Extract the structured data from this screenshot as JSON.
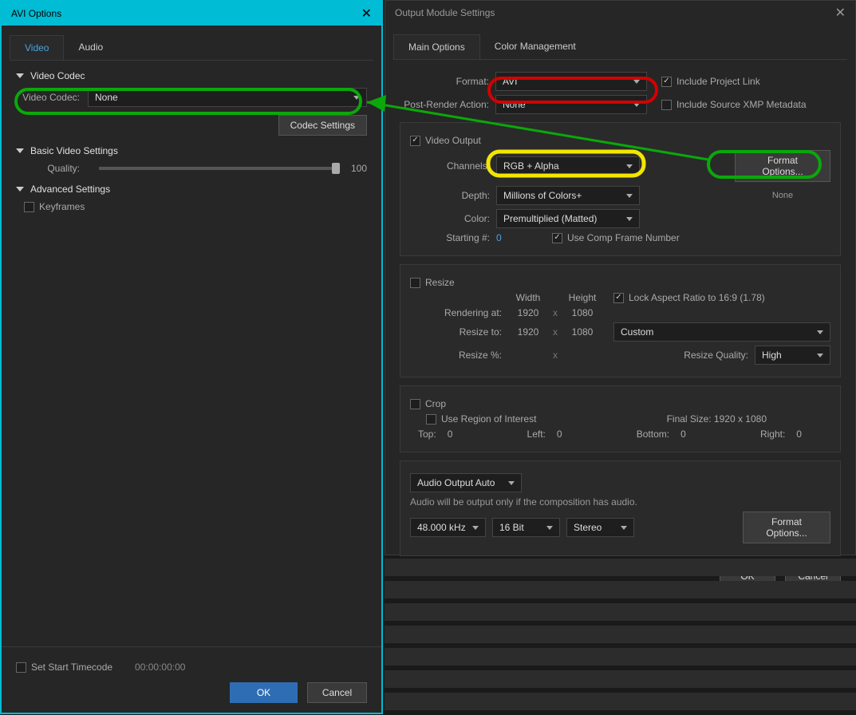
{
  "left": {
    "title": "AVI Options",
    "tabs": {
      "video": "Video",
      "audio": "Audio"
    },
    "sections": {
      "videoCodec": {
        "header": "Video Codec",
        "label": "Video Codec:",
        "value": "None",
        "codecSettingsBtn": "Codec Settings"
      },
      "basic": {
        "header": "Basic Video Settings",
        "qualityLabel": "Quality:",
        "qualityValue": "100"
      },
      "advanced": {
        "header": "Advanced Settings",
        "keyframesLabel": "Keyframes"
      }
    },
    "bottom": {
      "startTimecodeLabel": "Set Start Timecode",
      "timecode": "00:00:00:00",
      "ok": "OK",
      "cancel": "Cancel"
    }
  },
  "right": {
    "title": "Output Module Settings",
    "tabs": {
      "main": "Main Options",
      "color": "Color Management"
    },
    "formatRow": {
      "label": "Format:",
      "value": "AVI",
      "includeProject": "Include Project Link"
    },
    "postRender": {
      "label": "Post-Render Action:",
      "value": "None",
      "includeXMP": "Include Source XMP Metadata"
    },
    "videoOutput": {
      "header": "Video Output",
      "channelsLabel": "Channels:",
      "channelsValue": "RGB + Alpha",
      "formatOptionsBtn": "Format Options...",
      "depthLabel": "Depth:",
      "depthValue": "Millions of Colors+",
      "noneText": "None",
      "colorLabel": "Color:",
      "colorValue": "Premultiplied (Matted)",
      "startingLabel": "Starting #:",
      "startingValue": "0",
      "useCompFrame": "Use Comp Frame Number"
    },
    "resize": {
      "header": "Resize",
      "widthLabel": "Width",
      "heightLabel": "Height",
      "lockAspect": "Lock Aspect Ratio to 16:9 (1.78)",
      "renderingLabel": "Rendering at:",
      "renderW": "1920",
      "renderH": "1080",
      "resizeToLabel": "Resize to:",
      "resizeW": "1920",
      "resizeH": "1080",
      "customLabel": "Custom",
      "resizePctLabel": "Resize %:",
      "resizeQualityLabel": "Resize Quality:",
      "resizeQualityValue": "High"
    },
    "crop": {
      "header": "Crop",
      "useRegion": "Use Region of Interest",
      "finalSize": "Final Size: 1920 x 1080",
      "topLabel": "Top:",
      "topVal": "0",
      "leftLabel": "Left:",
      "leftVal": "0",
      "bottomLabel": "Bottom:",
      "bottomVal": "0",
      "rightLabel": "Right:",
      "rightVal": "0"
    },
    "audio": {
      "header": "Audio Output Auto",
      "note": "Audio will be output only if the composition has audio.",
      "rate": "48.000 kHz",
      "bits": "16 Bit",
      "channels": "Stereo",
      "formatOptionsBtn": "Format Options..."
    },
    "bottom": {
      "ok": "OK",
      "cancel": "Cancel"
    }
  }
}
